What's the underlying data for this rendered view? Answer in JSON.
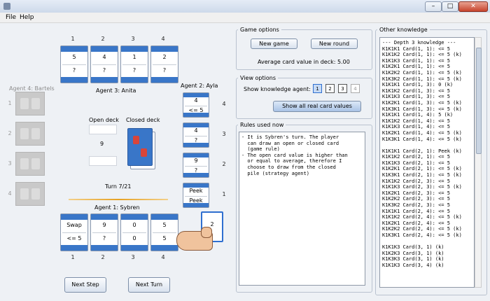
{
  "window": {
    "min_glyph": "–",
    "max_glyph": "□",
    "close_glyph": "✕"
  },
  "menu": [
    "File",
    "Help"
  ],
  "board": {
    "agent3": {
      "label": "Agent 3: Anita",
      "cols": [
        "1",
        "2",
        "3",
        "4"
      ],
      "cards": [
        [
          "5",
          "?"
        ],
        [
          "4",
          "?"
        ],
        [
          "1",
          "?"
        ],
        [
          "2",
          "?"
        ]
      ]
    },
    "agent4": {
      "label": "Agent 4: Bartels",
      "rows": [
        "1",
        "2",
        "3",
        "4"
      ]
    },
    "agent2": {
      "label": "Agent 2: Ayla",
      "rows": [
        "4",
        "3",
        "2",
        "1"
      ],
      "cards": [
        [
          "4",
          "<= 5"
        ],
        [
          "4",
          "?"
        ],
        [
          "9",
          "?"
        ],
        [
          "Peek",
          "Peek"
        ]
      ]
    },
    "agent1": {
      "label": "Agent 1: Sybren",
      "cols": [
        "1",
        "2",
        "3",
        "4"
      ],
      "cards": [
        [
          "Swap",
          "<= 5"
        ],
        [
          "9",
          "?"
        ],
        [
          "0",
          "0"
        ],
        [
          "5",
          "5"
        ]
      ]
    },
    "open_deck_label": "Open deck",
    "closed_deck_label": "Closed deck",
    "open_deck_value": "9",
    "turn": "Turn 7/21",
    "drawn_card": "2",
    "buttons": {
      "next_step": "Next Step",
      "next_turn": "Next Turn"
    }
  },
  "game_options": {
    "title": "Game options",
    "new_game": "New game",
    "new_round": "New round",
    "average": "Average card value in deck: 5.00"
  },
  "view_options": {
    "title": "View options",
    "show_label": "Show knowledge agent:",
    "agents": [
      "1",
      "2",
      "3",
      "4"
    ],
    "show_all": "Show all real card values"
  },
  "rules": {
    "title": "Rules used now",
    "text": "- It is Sybren's turn. The player\n  can draw an open or closed card\n  (game rule)\n- The open card value is higher than\n  or equal to average, therefore I\n  choose to draw from the closed\n  pile (strategy agent)"
  },
  "knowledge": {
    "title": "Other knowledge",
    "text": "--- Depth 3 knowledge ---\nK1K1K1 Card(1, 1): <= 5\nK1K1K2 Card(1, 1): <= 5 (k)\nK1K1K3 Card(1, 1): <= 5\nK1K2K1 Card(1, 1): <= 5\nK1K2K2 Card(1, 1): <= 5 (k)\nK1K3K2 Card(1, 1): <= 5 (k)\nK1K1K1 Card(1, 3): 0 (k)\nK1K1K2 Card(1, 3): <= 5\nK1K1K3 Card(1, 3): <= 5\nK1K2K1 Card(1, 3): <= 5 (k)\nK1K3K1 Card(1, 3): <= 5 (k)\nK1K1K1 Card(1, 4): 5 (k)\nK1K1K2 Card(1, 4): <= 5\nK1K1K3 Card(1, 4): <= 5\nK1K2K1 Card(1, 4): <= 5 (k)\nK1K3K1 Card(1, 4): <= 5 (k)\n\nK1K1K1 Card(2, 1): Peek (k)\nK1K1K2 Card(2, 1): <= 5\nK1K1K3 Card(2, 1): <= 5\nK1K2K1 Card(2, 1): <= 5 (k)\nK1K3K1 Card(2, 1): <= 5 (k)\nK1K1K2 Card(2, 3): <= 5\nK1K1K3 Card(2, 3): <= 5 (k)\nK1K2K1 Card(2, 3): <= 5\nK1K2K2 Card(2, 3): <= 5\nK1K3K2 Card(2, 3): <= 5\nK1K1K1 Card(2, 4): <= 5\nK1K1K2 Card(2, 4): <= 5 (k)\nK1K2K1 Card(2, 4): <= 5\nK1K2K2 Card(2, 4): <= 5 (k)\nK1K3K1 Card(2, 4): <= 5 (k)\n\nK1K1K3 Card(3, 1) (k)\nK1K2K3 Card(3, 1) (k)\nK1K3K3 Card(3, 1) (k)\nK1K1K3 Card(3, 4) (k)"
  }
}
